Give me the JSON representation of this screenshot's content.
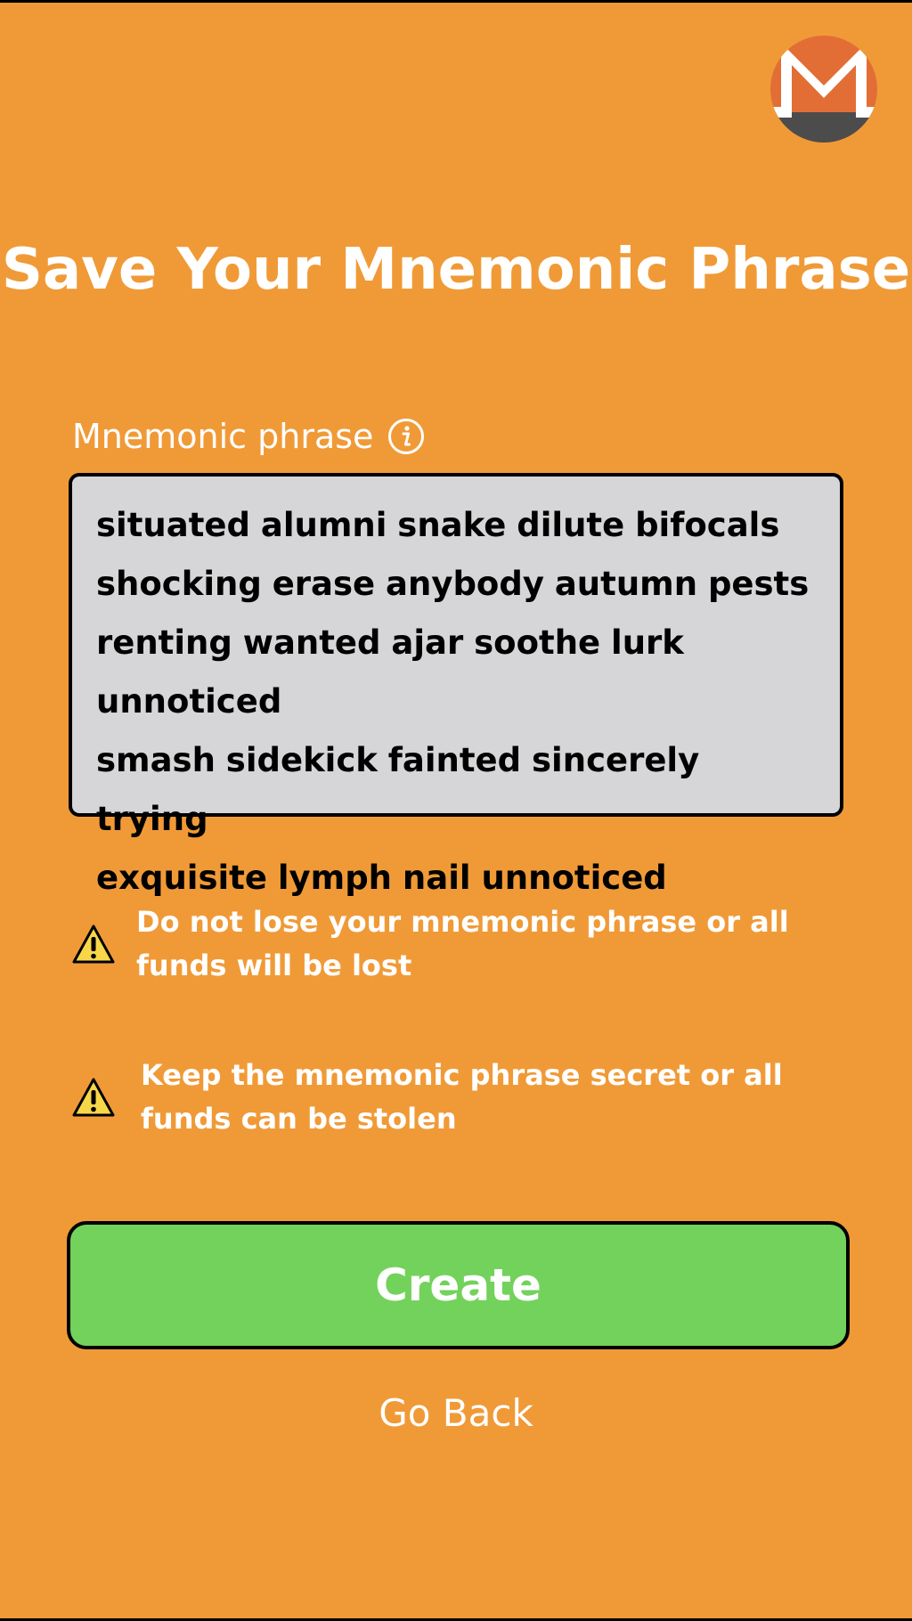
{
  "screen": {
    "title": "Save Your Mnemonic Phrase",
    "logo_icon": "monero-logo-icon"
  },
  "mnemonic": {
    "label": "Mnemonic phrase",
    "info_icon": "info-icon",
    "lines": [
      "situated alumni snake dilute bifocals",
      "shocking erase anybody autumn pests",
      "renting wanted ajar soothe lurk unnoticed",
      "smash sidekick fainted sincerely trying",
      "exquisite lymph nail unnoticed"
    ]
  },
  "warnings": [
    {
      "icon": "warning-icon",
      "text": "Do not lose your mnemonic phrase or all funds will be lost"
    },
    {
      "icon": "warning-icon",
      "text": "Keep the mnemonic phrase secret or all funds can be stolen"
    }
  ],
  "actions": {
    "create_label": "Create",
    "back_label": "Go Back"
  },
  "colors": {
    "background": "#F09A37",
    "phrase_box": "#D6D5D7",
    "create_button": "#73D25B",
    "logo_orange": "#E26E36",
    "logo_gray": "#4C4C4C"
  }
}
